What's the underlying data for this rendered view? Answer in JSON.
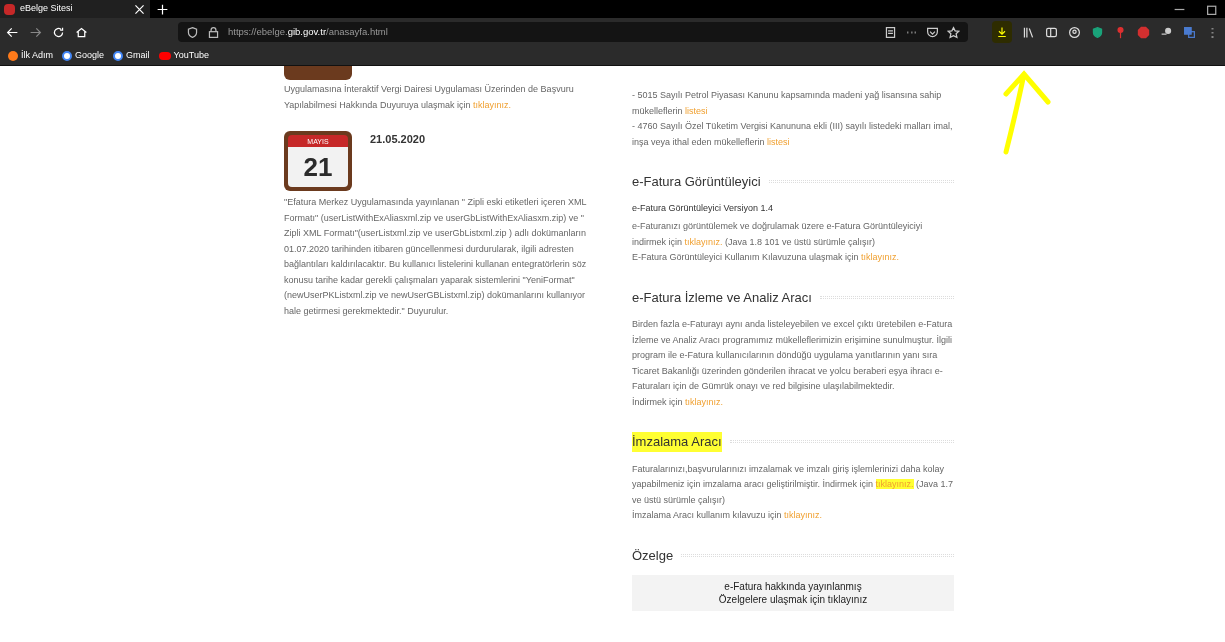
{
  "browser": {
    "tab": {
      "title": "eBelge Sitesi",
      "selected": true
    },
    "url": {
      "scheme": "https://ebelge.",
      "domain": "gib.gov.tr",
      "path": "/anasayfa.html"
    },
    "bookmarks": [
      {
        "label": "İlk Adım",
        "kind": "firefox"
      },
      {
        "label": "Google",
        "kind": "google"
      },
      {
        "label": "Gmail",
        "kind": "google"
      },
      {
        "label": "YouTube",
        "kind": "youtube"
      }
    ],
    "download_highlighted": true
  },
  "left_column": {
    "intro": [
      {
        "text": "Uygulamasına İnteraktif Vergi Dairesi Uygulaması Üzerinden de Başvuru Yapılabilmesi Hakkında Duyuruya ulaşmak için "
      },
      {
        "link": "tıklayınız.",
        "highlighted": false
      }
    ],
    "news": [
      {
        "month": "MAYIS",
        "day": "21",
        "date": "21.05.2020",
        "text": "\"Efatura Merkez Uygulamasında yayınlanan \" Zipli eski etiketleri içeren XML Formatı\" (userListWithExAliasxml.zip ve userGbListWithExAliasxm.zip) ve \" Zipli XML Formatı\"(userListxml.zip ve userGbListxml.zip ) adlı dokümanların 01.07.2020 tarihinden itibaren güncellenmesi durdurularak, ilgili adresten bağlantıları kaldırılacaktır. Bu kullanıcı listelerini kullanan entegratörlerin söz konusu tarihe kadar gerekli çalışmaları yaparak sistemlerini \"YeniFormat\"(newUserPKListxml.zip ve newUserGBListxml.zip) dokümanlarını kullanıyor hale getirmesi gerekmektedir.\" Duyurulur."
      }
    ]
  },
  "right_column": {
    "sections": [
      {
        "paragraphs": [
          [
            {
              "text": "- 5015 Sayılı Petrol Piyasası Kanunu kapsamında madeni yağ lisansına sahip mükelleflerin "
            },
            {
              "link": "listesi",
              "highlighted": false
            }
          ],
          [
            {
              "text": "- 4760 Sayılı Özel Tüketim Vergisi Kanununa ekli (III) sayılı listedeki malları imal, inşa veya ithal eden mükelleflerin "
            },
            {
              "link": "listesi",
              "highlighted": false
            }
          ]
        ]
      },
      {
        "heading": "e-Fatura Görüntüleyici",
        "highlighted": false,
        "subheading": "e-Fatura Görüntüleyici Versiyon 1.4",
        "paragraphs": [
          [
            {
              "text": "e-Faturanızı görüntülemek ve doğrulamak üzere e-Fatura Görüntüleyiciyi indirmek için "
            },
            {
              "link": "tıklayınız.",
              "highlighted": false
            },
            {
              "text": " (Java 1.8 101 ve üstü sürümle çalışır)"
            }
          ],
          [
            {
              "text": "E-Fatura Görüntüleyici Kullanım Kılavuzuna ulaşmak için "
            },
            {
              "link": "tıklayınız.",
              "highlighted": false
            }
          ]
        ]
      },
      {
        "heading": "e-Fatura İzleme ve Analiz Aracı",
        "highlighted": false,
        "paragraphs": [
          [
            {
              "text": "Birden fazla e-Faturayı aynı anda listeleyebilen ve excel çıktı üretebilen e-Fatura İzleme ve Analiz Aracı programımız mükelleflerimizin erişimine sunulmuştur. İlgili program ile e-Fatura kullanıcılarının döndüğü uygulama yanıtlarının yanı sıra Ticaret Bakanlığı üzerinden gönderilen ihracat ve yolcu beraberi eşya ihracı e-Faturaları için de Gümrük onayı ve red bilgisine ulaşılabilmektedir."
            }
          ],
          [
            {
              "text": "İndirmek için "
            },
            {
              "link": "tıklayınız.",
              "highlighted": false
            }
          ]
        ]
      },
      {
        "heading": "İmzalama Aracı",
        "highlighted": true,
        "paragraphs": [
          [
            {
              "text": "Faturalarınızı,başvurularınızı imzalamak ve imzalı giriş işlemlerinizi daha kolay yapabilmeniz için imzalama aracı geliştirilmiştir. İndirmek için "
            },
            {
              "link": "tıklayınız.",
              "highlighted": true
            },
            {
              "text": " (Java 1.7 ve üstü sürümle çalışır)"
            }
          ],
          [
            {
              "text": "İmzalama Aracı kullanım kılavuzu için "
            },
            {
              "link": "tıklayınız.",
              "highlighted": false
            }
          ]
        ]
      },
      {
        "heading": "Özelge",
        "highlighted": false,
        "button": [
          "e-Fatura hakkında yayınlanmış",
          "Özelgelere ulaşmak için tıklayınız"
        ]
      }
    ]
  }
}
